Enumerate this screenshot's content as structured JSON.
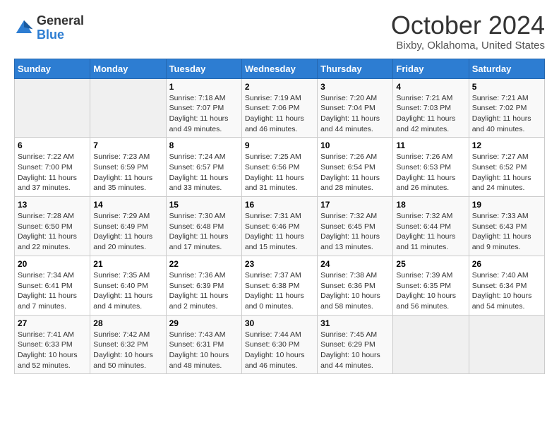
{
  "header": {
    "logo_general": "General",
    "logo_blue": "Blue",
    "title": "October 2024",
    "location": "Bixby, Oklahoma, United States"
  },
  "days_of_week": [
    "Sunday",
    "Monday",
    "Tuesday",
    "Wednesday",
    "Thursday",
    "Friday",
    "Saturday"
  ],
  "weeks": [
    [
      {
        "day": "",
        "empty": true
      },
      {
        "day": "",
        "empty": true
      },
      {
        "day": "1",
        "sunrise": "7:18 AM",
        "sunset": "7:07 PM",
        "daylight": "11 hours and 49 minutes."
      },
      {
        "day": "2",
        "sunrise": "7:19 AM",
        "sunset": "7:06 PM",
        "daylight": "11 hours and 46 minutes."
      },
      {
        "day": "3",
        "sunrise": "7:20 AM",
        "sunset": "7:04 PM",
        "daylight": "11 hours and 44 minutes."
      },
      {
        "day": "4",
        "sunrise": "7:21 AM",
        "sunset": "7:03 PM",
        "daylight": "11 hours and 42 minutes."
      },
      {
        "day": "5",
        "sunrise": "7:21 AM",
        "sunset": "7:02 PM",
        "daylight": "11 hours and 40 minutes."
      }
    ],
    [
      {
        "day": "6",
        "sunrise": "7:22 AM",
        "sunset": "7:00 PM",
        "daylight": "11 hours and 37 minutes."
      },
      {
        "day": "7",
        "sunrise": "7:23 AM",
        "sunset": "6:59 PM",
        "daylight": "11 hours and 35 minutes."
      },
      {
        "day": "8",
        "sunrise": "7:24 AM",
        "sunset": "6:57 PM",
        "daylight": "11 hours and 33 minutes."
      },
      {
        "day": "9",
        "sunrise": "7:25 AM",
        "sunset": "6:56 PM",
        "daylight": "11 hours and 31 minutes."
      },
      {
        "day": "10",
        "sunrise": "7:26 AM",
        "sunset": "6:54 PM",
        "daylight": "11 hours and 28 minutes."
      },
      {
        "day": "11",
        "sunrise": "7:26 AM",
        "sunset": "6:53 PM",
        "daylight": "11 hours and 26 minutes."
      },
      {
        "day": "12",
        "sunrise": "7:27 AM",
        "sunset": "6:52 PM",
        "daylight": "11 hours and 24 minutes."
      }
    ],
    [
      {
        "day": "13",
        "sunrise": "7:28 AM",
        "sunset": "6:50 PM",
        "daylight": "11 hours and 22 minutes."
      },
      {
        "day": "14",
        "sunrise": "7:29 AM",
        "sunset": "6:49 PM",
        "daylight": "11 hours and 20 minutes."
      },
      {
        "day": "15",
        "sunrise": "7:30 AM",
        "sunset": "6:48 PM",
        "daylight": "11 hours and 17 minutes."
      },
      {
        "day": "16",
        "sunrise": "7:31 AM",
        "sunset": "6:46 PM",
        "daylight": "11 hours and 15 minutes."
      },
      {
        "day": "17",
        "sunrise": "7:32 AM",
        "sunset": "6:45 PM",
        "daylight": "11 hours and 13 minutes."
      },
      {
        "day": "18",
        "sunrise": "7:32 AM",
        "sunset": "6:44 PM",
        "daylight": "11 hours and 11 minutes."
      },
      {
        "day": "19",
        "sunrise": "7:33 AM",
        "sunset": "6:43 PM",
        "daylight": "11 hours and 9 minutes."
      }
    ],
    [
      {
        "day": "20",
        "sunrise": "7:34 AM",
        "sunset": "6:41 PM",
        "daylight": "11 hours and 7 minutes."
      },
      {
        "day": "21",
        "sunrise": "7:35 AM",
        "sunset": "6:40 PM",
        "daylight": "11 hours and 4 minutes."
      },
      {
        "day": "22",
        "sunrise": "7:36 AM",
        "sunset": "6:39 PM",
        "daylight": "11 hours and 2 minutes."
      },
      {
        "day": "23",
        "sunrise": "7:37 AM",
        "sunset": "6:38 PM",
        "daylight": "11 hours and 0 minutes."
      },
      {
        "day": "24",
        "sunrise": "7:38 AM",
        "sunset": "6:36 PM",
        "daylight": "10 hours and 58 minutes."
      },
      {
        "day": "25",
        "sunrise": "7:39 AM",
        "sunset": "6:35 PM",
        "daylight": "10 hours and 56 minutes."
      },
      {
        "day": "26",
        "sunrise": "7:40 AM",
        "sunset": "6:34 PM",
        "daylight": "10 hours and 54 minutes."
      }
    ],
    [
      {
        "day": "27",
        "sunrise": "7:41 AM",
        "sunset": "6:33 PM",
        "daylight": "10 hours and 52 minutes."
      },
      {
        "day": "28",
        "sunrise": "7:42 AM",
        "sunset": "6:32 PM",
        "daylight": "10 hours and 50 minutes."
      },
      {
        "day": "29",
        "sunrise": "7:43 AM",
        "sunset": "6:31 PM",
        "daylight": "10 hours and 48 minutes."
      },
      {
        "day": "30",
        "sunrise": "7:44 AM",
        "sunset": "6:30 PM",
        "daylight": "10 hours and 46 minutes."
      },
      {
        "day": "31",
        "sunrise": "7:45 AM",
        "sunset": "6:29 PM",
        "daylight": "10 hours and 44 minutes."
      },
      {
        "day": "",
        "empty": true
      },
      {
        "day": "",
        "empty": true
      }
    ]
  ],
  "labels": {
    "sunrise": "Sunrise:",
    "sunset": "Sunset:",
    "daylight": "Daylight:"
  }
}
